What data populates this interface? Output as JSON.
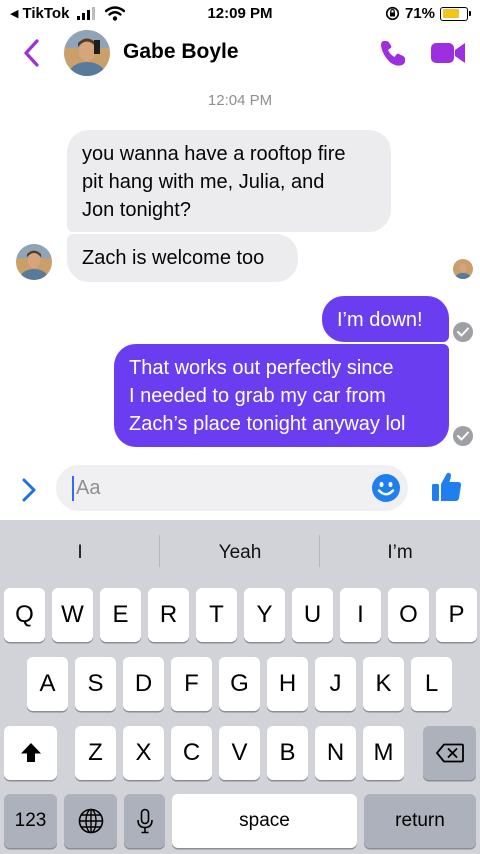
{
  "status_bar": {
    "back_app": "TikTok",
    "time": "12:09 PM",
    "battery": "71%",
    "battery_level": 0.71,
    "battery_color": "#f5c419"
  },
  "header": {
    "contact_name": "Gabe Boyle",
    "accent_color": "#9d2fe0",
    "icons": [
      "back-chevron-icon",
      "phone-icon",
      "video-camera-icon"
    ]
  },
  "chat": {
    "timestamp": "12:04 PM",
    "messages": [
      {
        "from": "contact",
        "lines": [
          "you wanna have a rooftop fire",
          "pit hang with me, Julia, and",
          "Jon tonight?"
        ]
      },
      {
        "from": "contact",
        "lines": [
          "Zach is welcome too"
        ]
      },
      {
        "from": "me",
        "lines": [
          "I’m down!"
        ]
      },
      {
        "from": "me",
        "lines": [
          "That works out perfectly since",
          "I needed to grab my car from",
          "Zach’s place tonight anyway lol"
        ]
      }
    ],
    "outgoing_color": "#6a3df0",
    "incoming_color": "#ececee"
  },
  "composer": {
    "placeholder": "Aa",
    "value": "",
    "icons": [
      "expand-chevron-icon",
      "emoji-icon",
      "thumbs-up-icon"
    ]
  },
  "keyboard": {
    "suggestions": [
      "I",
      "Yeah",
      "I’m"
    ],
    "row1": [
      "Q",
      "W",
      "E",
      "R",
      "T",
      "Y",
      "U",
      "I",
      "O",
      "P"
    ],
    "row2": [
      "A",
      "S",
      "D",
      "F",
      "G",
      "H",
      "J",
      "K",
      "L"
    ],
    "row3": [
      "Z",
      "X",
      "C",
      "V",
      "B",
      "N",
      "M"
    ],
    "numbers_label": "123",
    "space_label": "space",
    "return_label": "return"
  }
}
